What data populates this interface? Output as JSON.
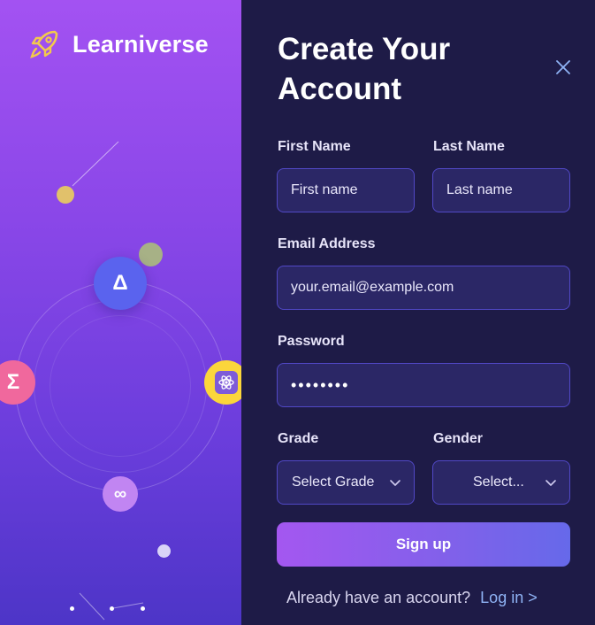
{
  "brand": {
    "name": "Learniverse",
    "icon": "rocket-icon"
  },
  "illustration": {
    "delta_symbol": "Δ",
    "sigma_symbol": "Σ",
    "infinity_symbol": "∞",
    "atom_icon": "atom-icon",
    "colors": {
      "delta": "#5a63ee",
      "sigma": "#f0689d",
      "atom": "#fbd63b",
      "infinity": "#c185f2"
    }
  },
  "form": {
    "title_line1": "Create Your",
    "title_line2": "Account",
    "close_icon": "close-icon",
    "first_name": {
      "label": "First Name",
      "placeholder": "First name",
      "value": ""
    },
    "last_name": {
      "label": "Last Name",
      "placeholder": "Last name",
      "value": ""
    },
    "email": {
      "label": "Email Address",
      "placeholder": "your.email@example.com",
      "value": ""
    },
    "password": {
      "label": "Password",
      "value": "••••••••"
    },
    "grade": {
      "label": "Grade",
      "selected": "Select Grade"
    },
    "gender": {
      "label": "Gender",
      "selected": "Select..."
    },
    "submit_label": "Sign up",
    "footer_text": "Already have an account?",
    "login_link": "Log in >"
  },
  "colors": {
    "panel_bg": "#1e1b47",
    "field_bg": "#2b2766",
    "field_border": "#5148c6",
    "link": "#8fb3f5"
  }
}
